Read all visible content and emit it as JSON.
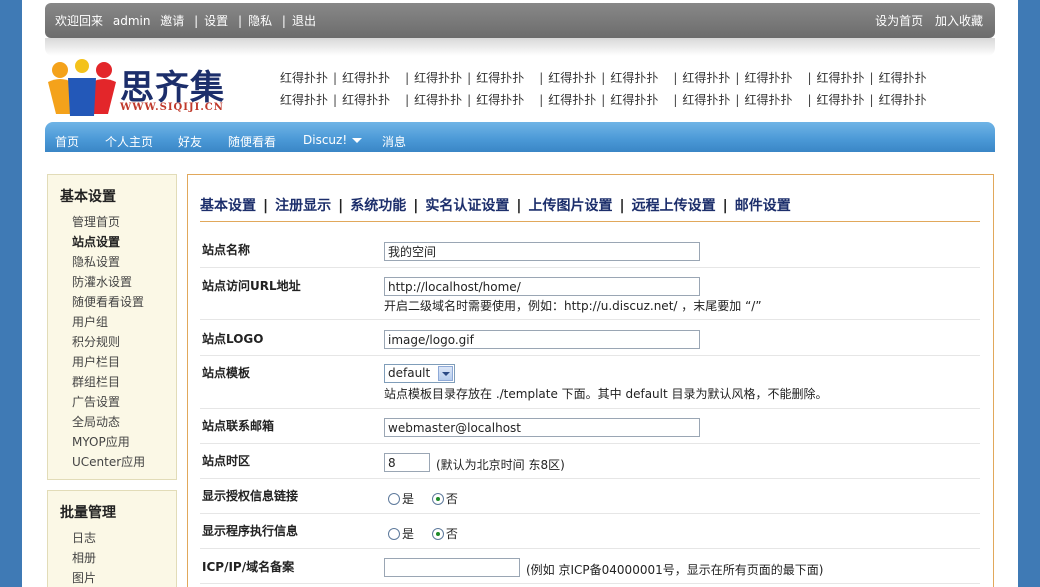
{
  "topbar": {
    "welcome": "欢迎回来",
    "username": "admin",
    "links": [
      "邀请",
      "设置",
      "隐私",
      "退出"
    ],
    "right_links": [
      "设为首页",
      "加入收藏"
    ]
  },
  "logo": {
    "brand": "思齐集",
    "url": "WWW.SIQIJI.CN"
  },
  "ads": {
    "row1": [
      "红得扑扑",
      "红得扑扑",
      "红得扑扑",
      "红得扑扑",
      "红得扑扑",
      "红得扑扑",
      "红得扑扑",
      "红得扑扑",
      "红得扑扑",
      "红得扑扑"
    ],
    "row2": [
      "红得扑扑",
      "红得扑扑",
      "红得扑扑",
      "红得扑扑",
      "红得扑扑",
      "红得扑扑",
      "红得扑扑",
      "红得扑扑",
      "红得扑扑",
      "红得扑扑"
    ]
  },
  "nav": {
    "items": [
      "首页",
      "个人主页",
      "好友",
      "随便看看",
      "Discuz!",
      "消息"
    ]
  },
  "sidebar": {
    "basic": {
      "title": "基本设置",
      "items": [
        "管理首页",
        "站点设置",
        "隐私设置",
        "防灌水设置",
        "随便看看设置",
        "用户组",
        "积分规则",
        "用户栏目",
        "群组栏目",
        "广告设置",
        "全局动态",
        "MYOP应用",
        "UCenter应用"
      ]
    },
    "batch": {
      "title": "批量管理",
      "items": [
        "日志",
        "相册",
        "图片"
      ]
    }
  },
  "tabs": [
    "基本设置",
    "注册显示",
    "系统功能",
    "实名认证设置",
    "上传图片设置",
    "远程上传设置",
    "邮件设置"
  ],
  "form": {
    "site_name": {
      "label": "站点名称",
      "value": "我的空间"
    },
    "site_url": {
      "label": "站点访问URL地址",
      "value": "http://localhost/home/",
      "hint": "开启二级域名时需要使用，例如：http://u.discuz.net/ ，末尾要加 “/”"
    },
    "site_logo": {
      "label": "站点LOGO",
      "value": "image/logo.gif"
    },
    "template": {
      "label": "站点模板",
      "value": "default",
      "hint": "站点模板目录存放在 ./template 下面。其中 default 目录为默认风格，不能删除。"
    },
    "email": {
      "label": "站点联系邮箱",
      "value": "webmaster@localhost"
    },
    "timezone": {
      "label": "站点时区",
      "value": "8",
      "hint": "(默认为北京时间 东8区)"
    },
    "show_license": {
      "label": "显示授权信息链接",
      "yes": "是",
      "no": "否",
      "selected": "否"
    },
    "show_debug": {
      "label": "显示程序执行信息",
      "yes": "是",
      "no": "否",
      "selected": "否"
    },
    "icp": {
      "label": "ICP/IP/域名备案",
      "value": "",
      "hint": "(例如 京ICP备04000001号，显示在所有页面的最下面)"
    }
  }
}
